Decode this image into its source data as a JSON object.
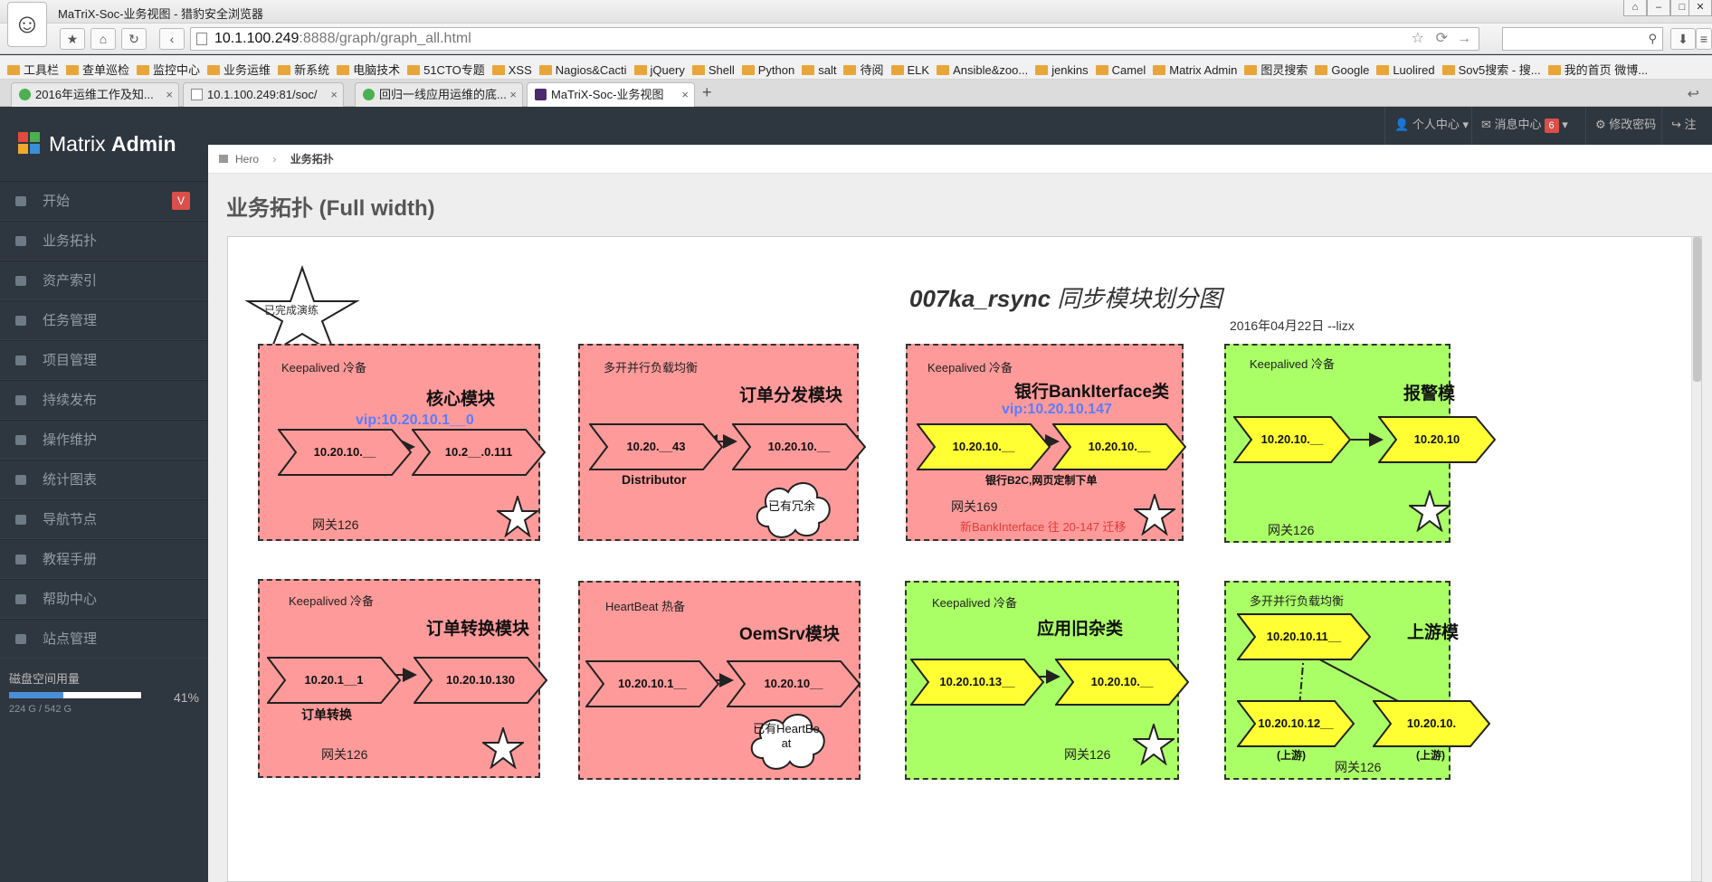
{
  "browser": {
    "title": "MaTriX-Soc-业务视图 - 猎豹安全浏览器",
    "url_host": "10.1.100.249",
    "url_path": ":8888/graph/graph_all.html",
    "bookmarks": [
      "工具栏",
      "查单巡检",
      "监控中心",
      "业务运维",
      "新系统",
      "电脑技术",
      "51CTO专题",
      "XSS",
      "Nagios&Cacti",
      "jQuery",
      "Shell",
      "Python",
      "salt",
      "待阅",
      "ELK",
      "Ansible&zoo...",
      "jenkins",
      "Camel",
      "Matrix Admin",
      "图灵搜索",
      "Google",
      "Luolired",
      "Sov5搜索 - 搜...",
      "我的首页 微博..."
    ],
    "tabs": [
      {
        "label": "2016年运维工作及知..."
      },
      {
        "label": "10.1.100.249:81/soc/"
      },
      {
        "label": "回归一线应用运维的底..."
      },
      {
        "label": "MaTriX-Soc-业务视图"
      }
    ],
    "new_tab": "+"
  },
  "header": {
    "logo_plain": "Matrix",
    "logo_bold": "Admin",
    "user_center": "个人中心",
    "msg_center": "消息中心",
    "msg_count": "6",
    "change_pwd": "修改密码",
    "logout": "注销"
  },
  "sidebar": {
    "items": [
      {
        "label": "开始",
        "badge": "V"
      },
      {
        "label": "业务拓扑"
      },
      {
        "label": "资产索引"
      },
      {
        "label": "任务管理"
      },
      {
        "label": "项目管理"
      },
      {
        "label": "持续发布"
      },
      {
        "label": "操作维护"
      },
      {
        "label": "统计图表"
      },
      {
        "label": "导航节点"
      },
      {
        "label": "教程手册"
      },
      {
        "label": "帮助中心"
      },
      {
        "label": "站点管理"
      }
    ],
    "disk": {
      "title": "磁盘空间用量",
      "percent": "41%",
      "fraction": 0.41,
      "usage": "224 G / 542 G"
    }
  },
  "breadcrumb": {
    "home": "Hero",
    "current": "业务拓扑"
  },
  "page_title": "业务拓扑 (Full width)",
  "graph": {
    "title_bold": "007ka_rsync",
    "title_rest": " 同步模块划分图",
    "subtitle": "2016年04月22日 --lizx",
    "legend_star": "已完成演练",
    "modules": [
      {
        "ha": "Keepalived 冷备",
        "title": "核心模块",
        "vip": "vip:10.20.10.1__0",
        "nodes": [
          "10.20.10.__",
          "10.2__.0.111"
        ],
        "gw": "网关126"
      },
      {
        "ha": "多开并行负载均衡",
        "title": "订单分发模块",
        "nodes": [
          "10.20.__43",
          "10.20.10.__"
        ],
        "note": "Distributor",
        "cloud": "已有冗余"
      },
      {
        "ha": "Keepalived 冷备",
        "title": "银行BankIterface类",
        "vip": "vip:10.20.10.147",
        "nodes": [
          "10.20.10.__",
          "10.20.10.__"
        ],
        "note": "银行B2C,网页定制下单",
        "gw": "网关169",
        "red": "新BankInterface 往 20-147 迁移"
      },
      {
        "ha": "Keepalived 冷备",
        "title": "报警模",
        "nodes": [
          "10.20.10.__",
          "10.20.10"
        ],
        "gw": "网关126"
      },
      {
        "ha": "Keepalived 冷备",
        "title": "订单转换模块",
        "nodes": [
          "10.20.1__1",
          "10.20.10.130"
        ],
        "note": "订单转换",
        "gw": "网关126"
      },
      {
        "ha": "HeartBeat 热备",
        "title": "OemSrv模块",
        "nodes": [
          "10.20.10.1__",
          "10.20.10__"
        ],
        "cloud": "已有HeartBeat"
      },
      {
        "ha": "Keepalived 冷备",
        "title": "应用旧杂类",
        "nodes": [
          "10.20.10.13__",
          "10.20.10.__"
        ],
        "gw": "网关126"
      },
      {
        "ha": "多开并行负载均衡",
        "title": "上游模",
        "nodes": [
          "10.20.10.11__",
          "10.20.10.12__",
          "10.20.10."
        ],
        "sub": [
          "(上游)",
          "(上游)"
        ],
        "gw": "网关126"
      }
    ]
  }
}
